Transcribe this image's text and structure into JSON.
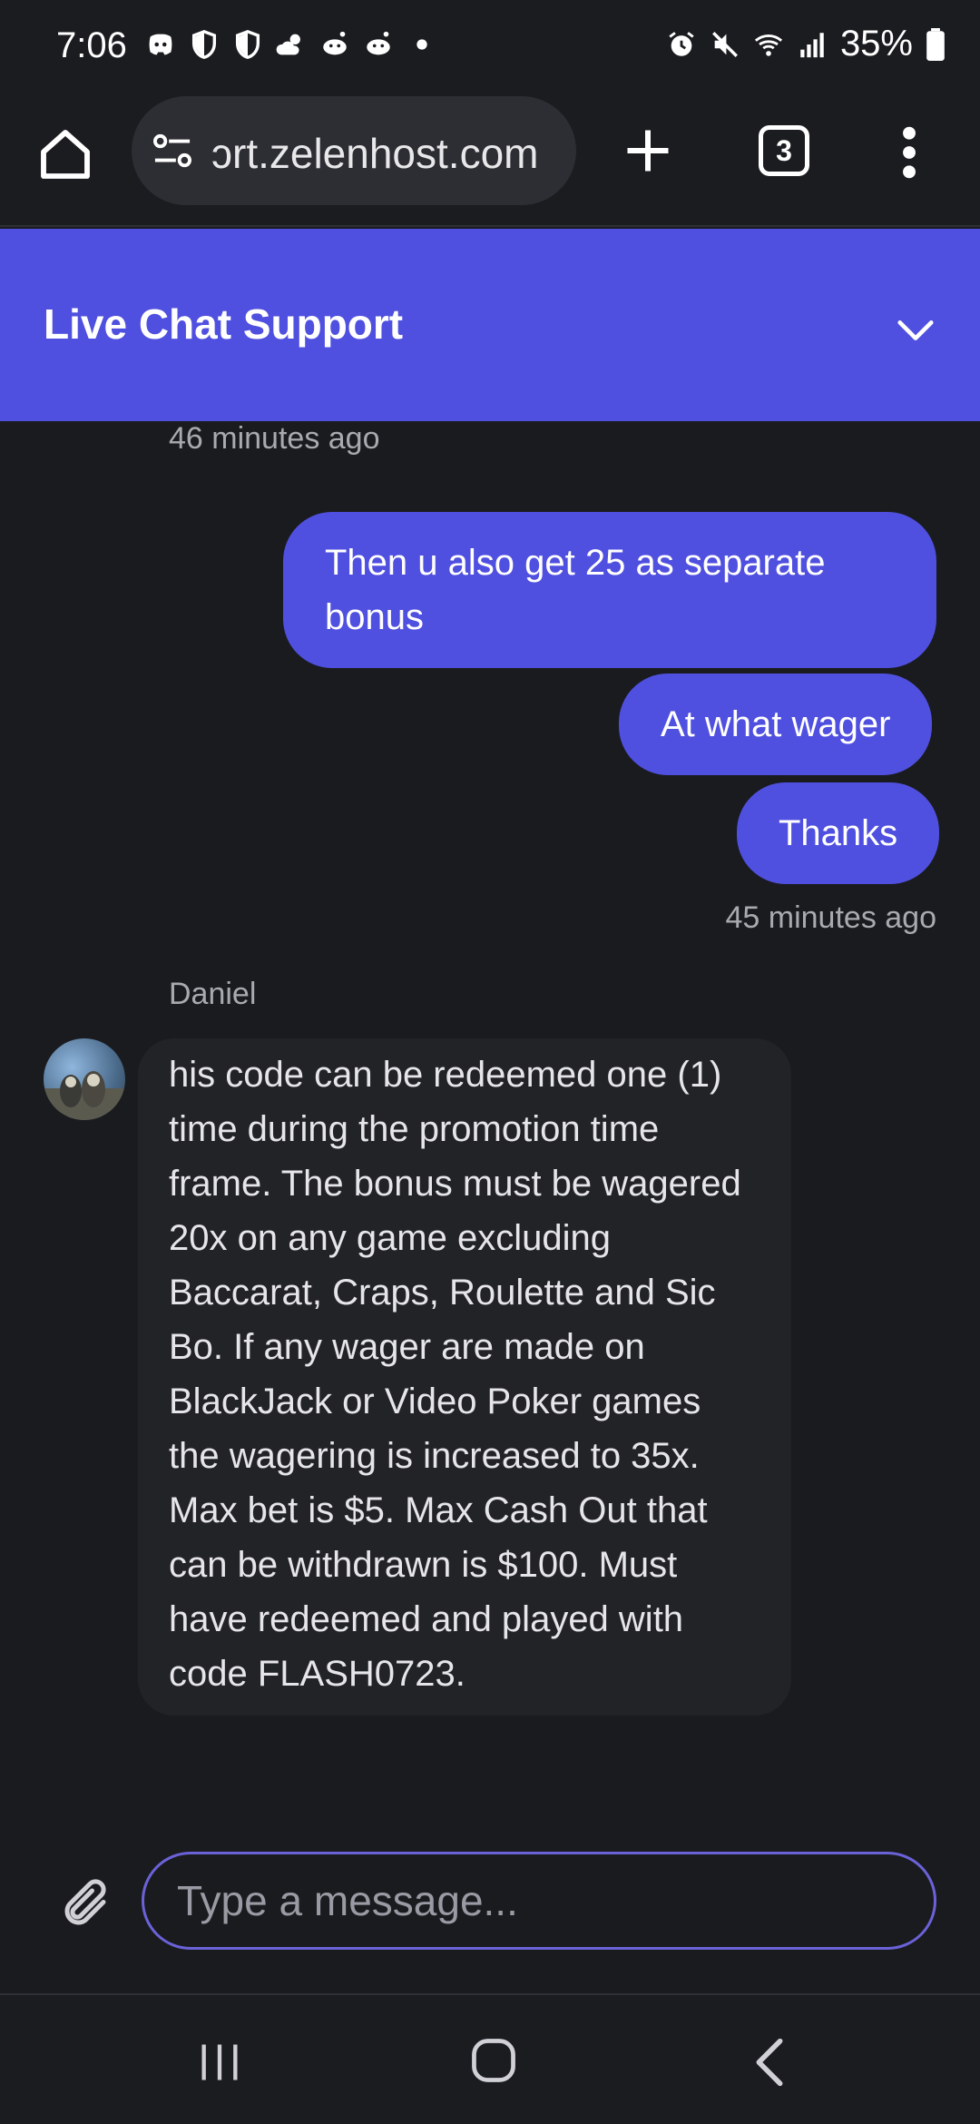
{
  "status_bar": {
    "time": "7:06",
    "battery": "35%",
    "left_icons": [
      "discord-icon",
      "shield-icon",
      "shield-icon",
      "weather-icon",
      "reddit-icon",
      "reddit-icon",
      "dot-icon"
    ],
    "right_icons": [
      "alarm-icon",
      "mute-icon",
      "wifi-icon",
      "signal-icon",
      "battery-icon"
    ]
  },
  "browser": {
    "url": "ɔrt.zelenhost.com",
    "tab_count": "3"
  },
  "chat": {
    "title": "Live Chat Support",
    "timestamp_top": "46 minutes ago",
    "user_messages": [
      "Then u also get 25 as separate bonus",
      "At what wager",
      "Thanks"
    ],
    "timestamp_user": "45 minutes ago",
    "agent_name": "Daniel",
    "agent_message": " his code can be redeemed one (1) time during the promotion time frame. The bonus must be wagered 20x on any game excluding Baccarat, Craps, Roulette and Sic Bo. If any wager are made on BlackJack or Video Poker games the wagering is increased to 35x. Max bet is $5. Max Cash Out that can be withdrawn is $100. Must have redeemed and played with code FLASH0723."
  },
  "composer": {
    "placeholder": "Type a message..."
  },
  "colors": {
    "accent": "#5050e0",
    "background": "#1a1b1e",
    "agent_bubble": "#222327",
    "input_border": "#6b62d8"
  }
}
